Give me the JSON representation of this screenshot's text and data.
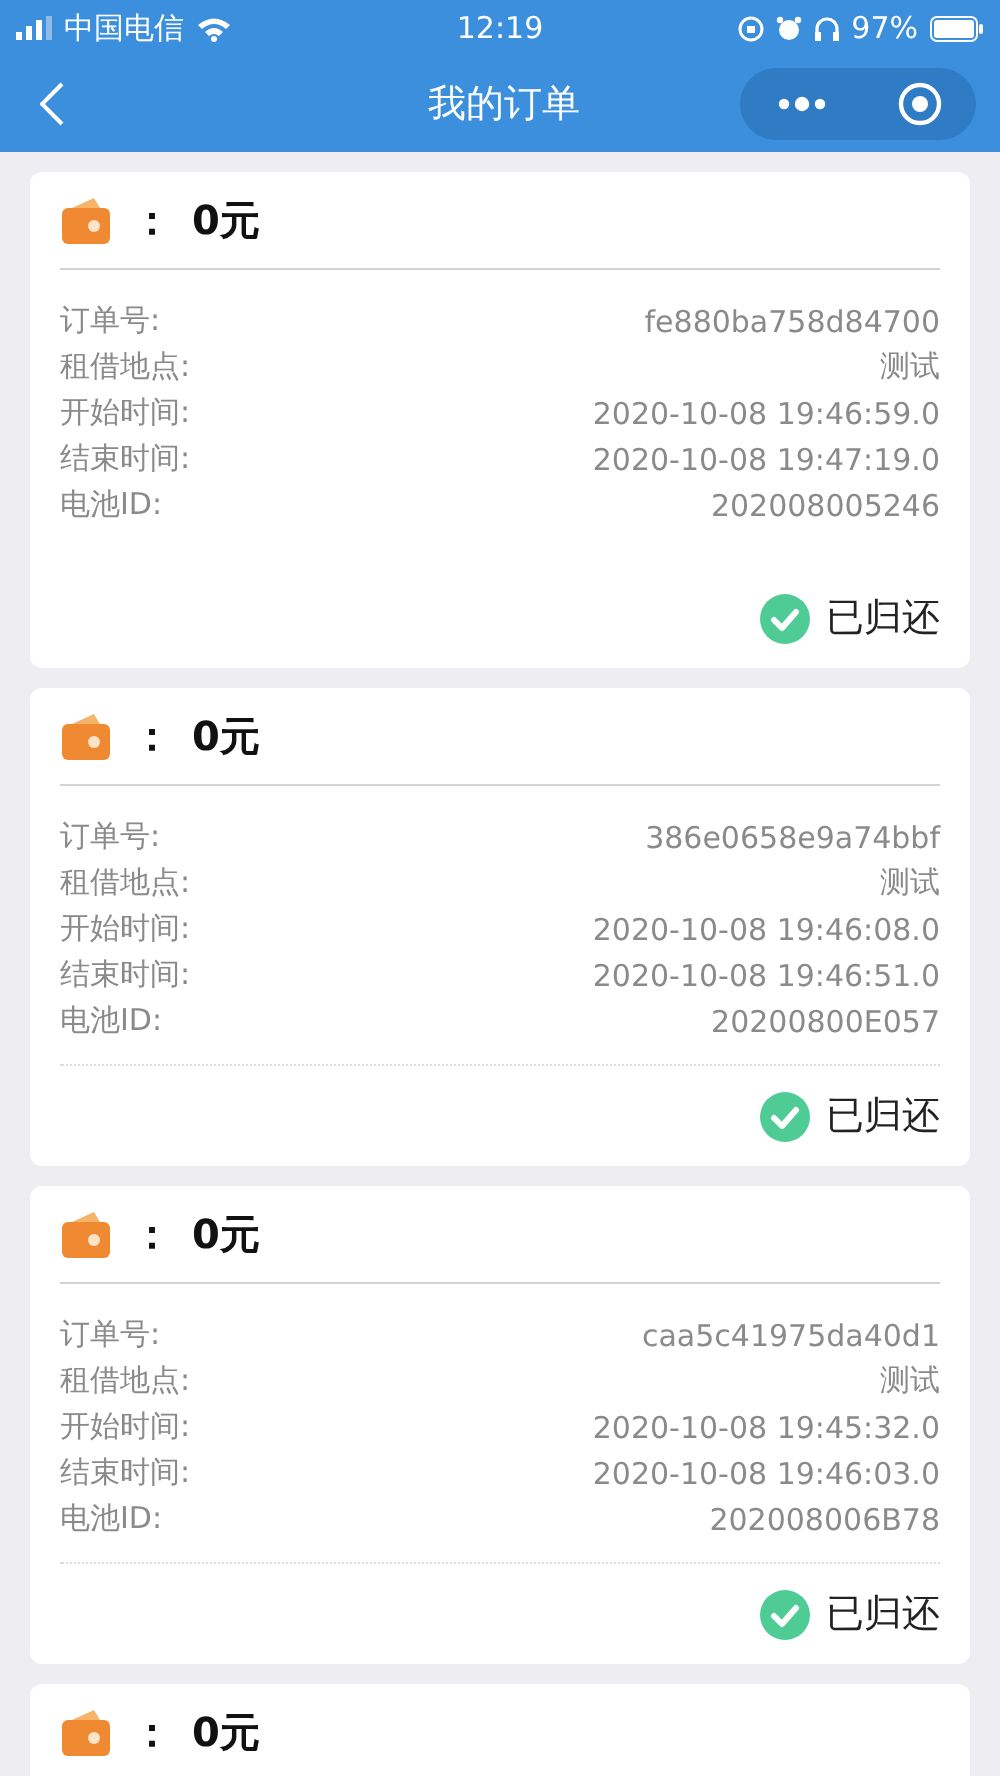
{
  "status_bar": {
    "carrier": "中国电信",
    "time": "12:19",
    "battery": "97%"
  },
  "nav": {
    "title": "我的订单"
  },
  "orders": [
    {
      "separator": "：",
      "amount": "0元",
      "fields": [
        {
          "label": "订单号:",
          "value": "fe880ba758d84700"
        },
        {
          "label": "租借地点:",
          "value": "测试"
        },
        {
          "label": "开始时间:",
          "value": "2020-10-08 19:46:59.0"
        },
        {
          "label": "结束时间:",
          "value": "2020-10-08 19:47:19.0"
        },
        {
          "label": "电池ID:",
          "value": "202008005246"
        }
      ],
      "footer_divider": false,
      "status": {
        "kind": "returned",
        "label": "已归还"
      }
    },
    {
      "separator": "：",
      "amount": "0元",
      "fields": [
        {
          "label": "订单号:",
          "value": "386e0658e9a74bbf"
        },
        {
          "label": "租借地点:",
          "value": "测试"
        },
        {
          "label": "开始时间:",
          "value": "2020-10-08 19:46:08.0"
        },
        {
          "label": "结束时间:",
          "value": "2020-10-08 19:46:51.0"
        },
        {
          "label": "电池ID:",
          "value": "20200800E057"
        }
      ],
      "footer_divider": true,
      "status": {
        "kind": "returned",
        "label": "已归还"
      }
    },
    {
      "separator": "：",
      "amount": "0元",
      "fields": [
        {
          "label": "订单号:",
          "value": "caa5c41975da40d1"
        },
        {
          "label": "租借地点:",
          "value": "测试"
        },
        {
          "label": "开始时间:",
          "value": "2020-10-08 19:45:32.0"
        },
        {
          "label": "结束时间:",
          "value": "2020-10-08 19:46:03.0"
        },
        {
          "label": "电池ID:",
          "value": "202008006B78"
        }
      ],
      "footer_divider": true,
      "status": {
        "kind": "returned",
        "label": "已归还"
      }
    },
    {
      "separator": "：",
      "amount": "0元"
    }
  ]
}
